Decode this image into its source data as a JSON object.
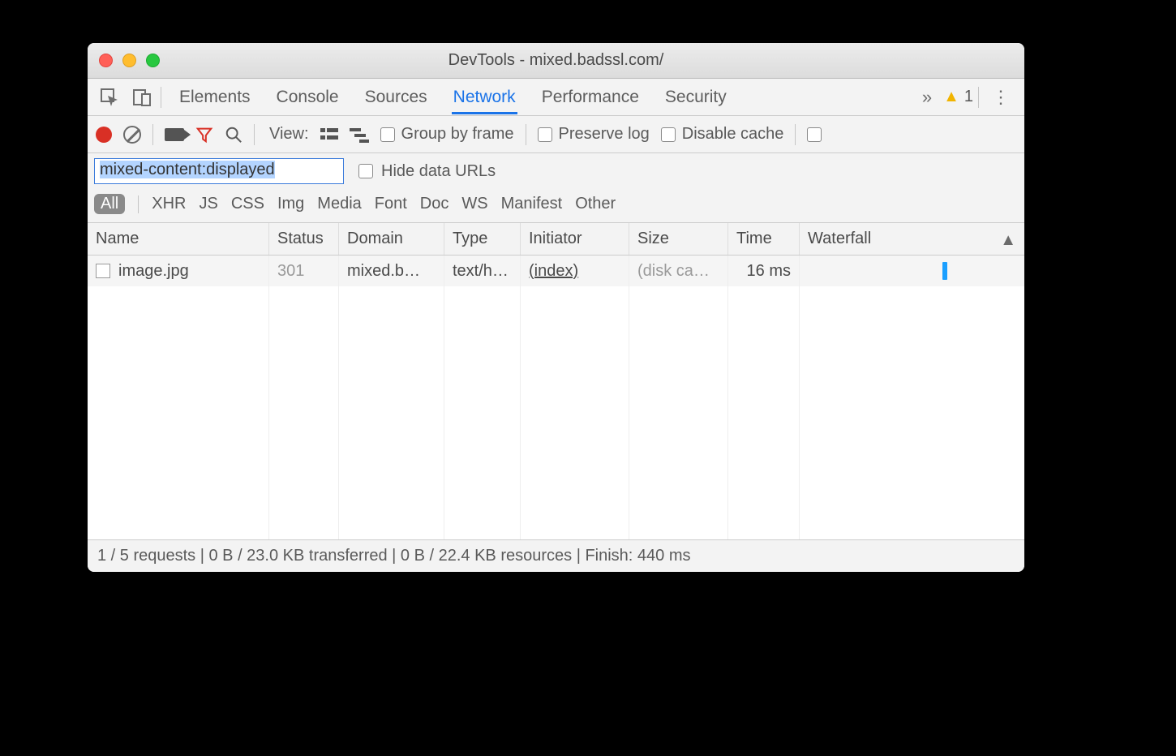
{
  "window": {
    "title": "DevTools - mixed.badssl.com/"
  },
  "tabs": {
    "items": [
      "Elements",
      "Console",
      "Sources",
      "Network",
      "Performance",
      "Security"
    ],
    "active_index": 3,
    "warning_count": "1"
  },
  "toolbar": {
    "view_label": "View:",
    "group_by_frame": "Group by frame",
    "preserve_log": "Preserve log",
    "disable_cache": "Disable cache"
  },
  "filter": {
    "value": "mixed-content:displayed",
    "hide_data_urls": "Hide data URLs",
    "types": [
      "All",
      "XHR",
      "JS",
      "CSS",
      "Img",
      "Media",
      "Font",
      "Doc",
      "WS",
      "Manifest",
      "Other"
    ],
    "active_type_index": 0
  },
  "table": {
    "columns": [
      "Name",
      "Status",
      "Domain",
      "Type",
      "Initiator",
      "Size",
      "Time",
      "Waterfall"
    ],
    "sort_column_index": 7,
    "rows": [
      {
        "name": "image.jpg",
        "status": "301",
        "domain": "mixed.b…",
        "type": "text/h…",
        "initiator": "(index)",
        "size": "(disk ca…",
        "time": "16 ms"
      }
    ]
  },
  "status": {
    "text": "1 / 5 requests | 0 B / 23.0 KB transferred | 0 B / 22.4 KB resources | Finish: 440 ms"
  }
}
